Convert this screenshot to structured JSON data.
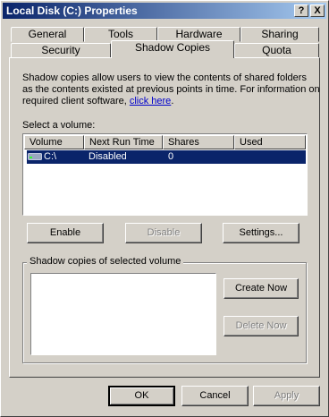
{
  "window": {
    "title": "Local Disk (C:) Properties",
    "help_glyph": "?",
    "close_glyph": "X"
  },
  "tabs": {
    "row1": [
      "General",
      "Tools",
      "Hardware",
      "Sharing"
    ],
    "row2": [
      "Security",
      "Shadow Copies",
      "Quota"
    ],
    "selected": "Shadow Copies"
  },
  "description": {
    "line1": "Shadow copies allow users to view the contents of shared folders",
    "line2": "as the contents existed at previous points in time. For information on",
    "line3_prefix": "required client software, ",
    "link": "click here",
    "line3_suffix": "."
  },
  "volume_label": "Select a volume:",
  "columns": [
    "Volume",
    "Next Run Time",
    "Shares",
    "Used"
  ],
  "volumes": [
    {
      "volume": "C:\\",
      "next_run_time": "Disabled",
      "shares": "0",
      "used": ""
    }
  ],
  "buttons": {
    "enable": "Enable",
    "disable": "Disable",
    "settings": "Settings...",
    "create_now": "Create Now",
    "delete_now": "Delete Now",
    "ok": "OK",
    "cancel": "Cancel",
    "apply": "Apply"
  },
  "group_label": "Shadow copies of selected volume",
  "colors": {
    "selection": "#0a246a",
    "face": "#d4d0c8",
    "link": "#0000cc"
  }
}
